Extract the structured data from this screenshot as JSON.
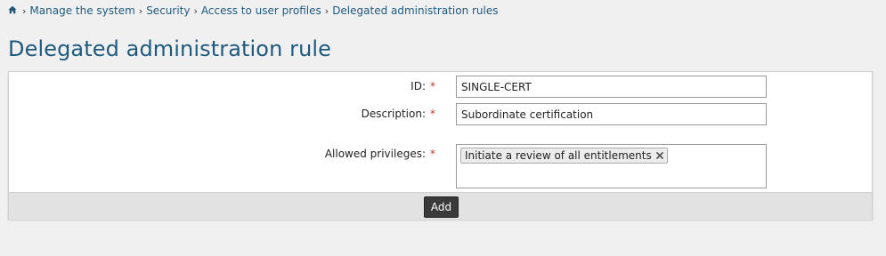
{
  "breadcrumb": {
    "home_icon": "home-icon",
    "items": [
      "Manage the system",
      "Security",
      "Access to user profiles",
      "Delegated administration rules"
    ],
    "separator": "›"
  },
  "page": {
    "title": "Delegated administration rule"
  },
  "form": {
    "id": {
      "label": "ID:",
      "required_mark": "*",
      "value": "SINGLE-CERT"
    },
    "description": {
      "label": "Description:",
      "required_mark": "*",
      "value": "Subordinate certification"
    },
    "allowed_privileges": {
      "label": "Allowed privileges:",
      "required_mark": "*",
      "tags": [
        "Initiate a review of all entitlements"
      ],
      "remove_icon": "close-icon"
    }
  },
  "footer": {
    "add_label": "Add"
  },
  "colors": {
    "link": "#1f5a7e",
    "title": "#1f5a7e",
    "required": "#c0392b",
    "button_bg": "#3a3a3a",
    "footer_bg": "#e2e2e2",
    "page_bg": "#f0f0f0"
  }
}
